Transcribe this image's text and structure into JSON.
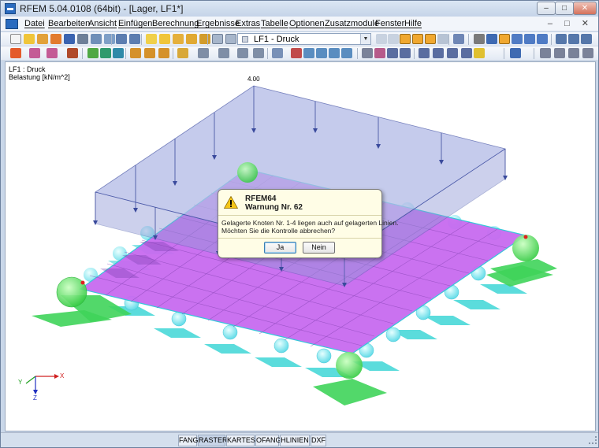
{
  "window": {
    "title": "RFEM 5.04.0108 (64bit) - [Lager, LF1*]",
    "controls": {
      "minimize": "–",
      "maximize": "□",
      "close": "✕"
    }
  },
  "menu": {
    "items": [
      "Datei",
      "Bearbeiten",
      "Ansicht",
      "Einfügen",
      "Berechnung",
      "Ergebnisse",
      "Extras",
      "Tabelle",
      "Optionen",
      "Zusatzmodule",
      "Fenster",
      "Hilfe"
    ],
    "mdi_controls": "– □ ✕"
  },
  "toolbar": {
    "load_case": "LF1 - Druck"
  },
  "viewport": {
    "info_line1": "LF1 : Druck",
    "info_line2": "Belastung [kN/m^2]",
    "load_value": "4.00",
    "axes": {
      "x": "X",
      "y": "Y",
      "z": "Z"
    },
    "colors": {
      "slab": "#c86bf0",
      "load_block": "#8f99d6",
      "support_ball": "#7fe8f0",
      "support_plate": "#3ed6d6",
      "corner_support": "#3fd45a"
    }
  },
  "dialog": {
    "title": "RFEM64",
    "subtitle": "Warnung Nr. 62",
    "message_line1": "Gelagerte Knoten Nr. 1-4 liegen auch auf gelagerten Linien.",
    "message_line2": "Möchten Sie die Kontrolle abbrechen?",
    "yes": "Ja",
    "no": "Nein"
  },
  "statusbar": {
    "buttons": [
      "FANG",
      "RASTER",
      "KARTES",
      "OFANG",
      "HLINIEN",
      "DXF"
    ],
    "active": "RASTER"
  }
}
